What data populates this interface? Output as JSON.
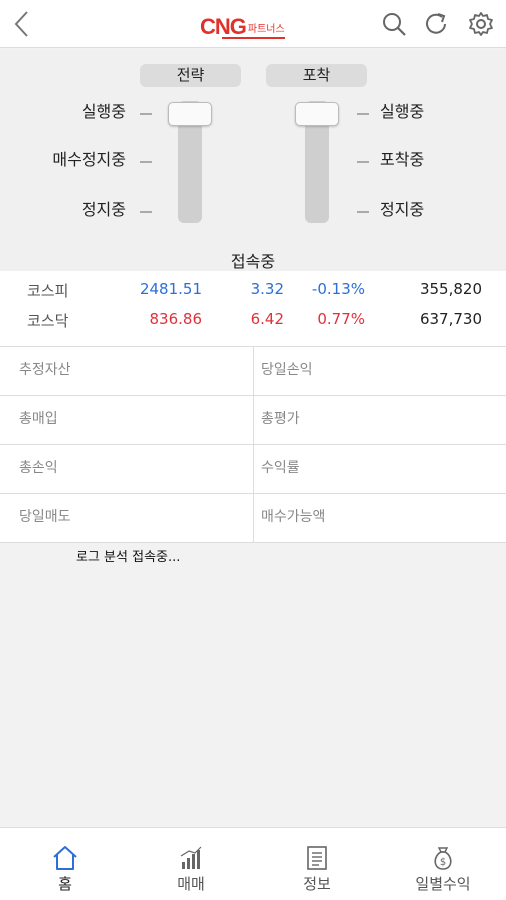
{
  "header": {
    "logo_main": "CNG",
    "logo_sub": "파트너스"
  },
  "panel": {
    "left_tag": "전략",
    "right_tag": "포착",
    "left_labels": [
      "실행중",
      "매수정지중",
      "정지중"
    ],
    "right_labels": [
      "실행중",
      "포착중",
      "정지중"
    ],
    "status": "접속중"
  },
  "indices": [
    {
      "name": "코스피",
      "value": "2481.51",
      "change": "3.32",
      "pct": "-0.13%",
      "volume": "355,820",
      "color": "#2d6fd6"
    },
    {
      "name": "코스닥",
      "value": "836.86",
      "change": "6.42",
      "pct": "0.77%",
      "volume": "637,730",
      "color": "#e0313b"
    }
  ],
  "grid": {
    "cells": [
      "추정자산",
      "당일손익",
      "총매입",
      "총평가",
      "총손익",
      "수익률",
      "당일매도",
      "매수가능액"
    ]
  },
  "log_text": "로그 분석 접속중...",
  "nav": {
    "items": [
      "홈",
      "매매",
      "정보",
      "일별수익"
    ],
    "active_color": "#2d6fd6"
  }
}
